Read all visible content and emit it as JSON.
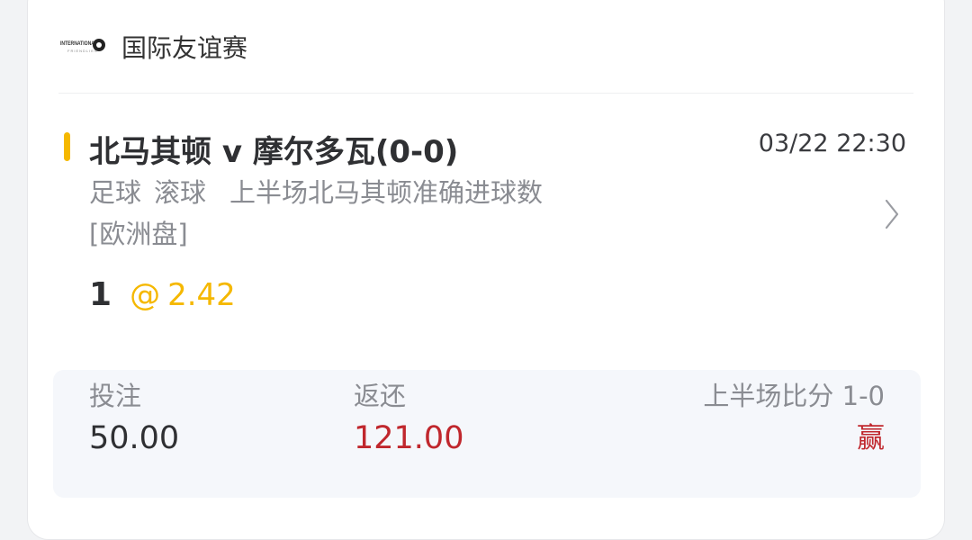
{
  "league": {
    "logo_text_top": "INTERNATIONAL",
    "logo_text_bottom": "FRIENDLIES",
    "name": "国际友谊赛"
  },
  "match": {
    "title": "北马其顿 v 摩尔多瓦(0-0)",
    "time": "03/22 22:30"
  },
  "bet": {
    "sport": "足球",
    "mode": "滚球",
    "market": "上半场北马其顿准确进球数",
    "odds_type": "[欧洲盘]",
    "selection": "1",
    "at_symbol": "@",
    "odds": "2.42"
  },
  "summary": {
    "stake_label": "投注",
    "stake_value": "50.00",
    "return_label": "返还",
    "return_value": "121.00",
    "result_label": "上半场比分 1-0",
    "result_value": "赢"
  },
  "colors": {
    "accent": "#f5b800",
    "win_red": "#c0272d"
  },
  "icons": {
    "chevron": "chevron-right-icon",
    "logo": "international-friendlies-logo"
  }
}
